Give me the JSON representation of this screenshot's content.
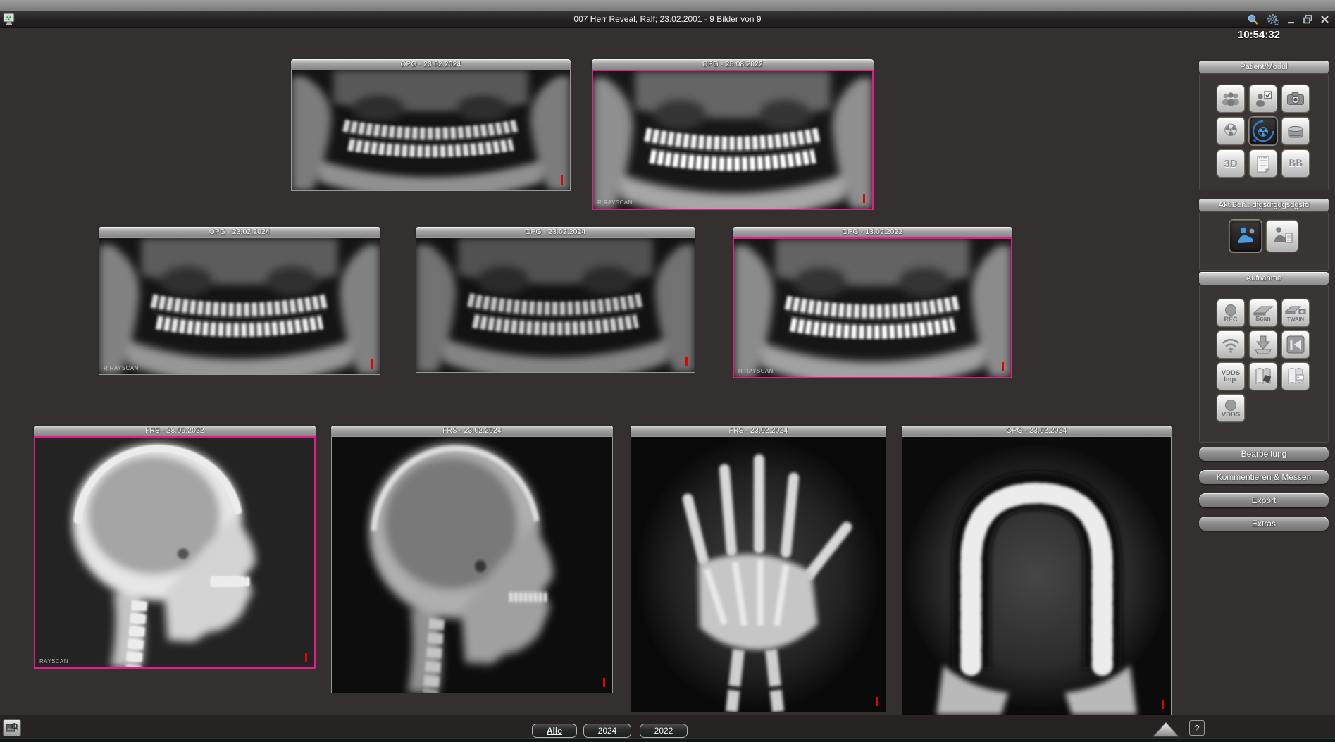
{
  "titlebar": {
    "title": "007 Herr Reveal, Ralf; 23.02.2001 - 9 Bilder von 9"
  },
  "clock": "10:54:32",
  "thumbnails": [
    {
      "label": "OPG - 23.02.2024",
      "selected": false,
      "watermark": ""
    },
    {
      "label": "OPG - 25.08.2022",
      "selected": true,
      "watermark": "R RAYSCAN"
    },
    {
      "label": "OPG - 23.02.2024",
      "selected": false,
      "watermark": "R RAYSCAN"
    },
    {
      "label": "OPG - 23.02.2024",
      "selected": false,
      "watermark": ""
    },
    {
      "label": "OPG - 13.09.2022",
      "selected": true,
      "watermark": "R RAYSCAN"
    },
    {
      "label": "FRS - 28.06.2022",
      "selected": true,
      "watermark": "RAYSCAN"
    },
    {
      "label": "FRS - 23.02.2024",
      "selected": false,
      "watermark": ""
    },
    {
      "label": "FRS - 23.02.2024",
      "selected": false,
      "watermark": ""
    },
    {
      "label": "OPG - 23.02.2024",
      "selected": false,
      "watermark": ""
    }
  ],
  "sidebar": {
    "patient_modul": {
      "title": "Patient/Modul",
      "label_3d": "3D",
      "label_bb": "BB"
    },
    "akt_beh": {
      "title": "Akt.Beh.: dfgsdfgdgsdgsfd"
    },
    "aufnahme": {
      "title": "Aufnahme",
      "rec": "REC",
      "scan": "Scan",
      "twain": "TWAIN",
      "vdds1": "VDDS",
      "vdds2": "Imp.",
      "vdds": "VDDS"
    },
    "buttons": [
      "Bearbeitung",
      "Kommentieren & Messen",
      "Export",
      "Extras"
    ]
  },
  "tabs": [
    {
      "label": "Alle",
      "active": true
    },
    {
      "label": "2024",
      "active": false
    },
    {
      "label": "2022",
      "active": false
    }
  ],
  "help": "?"
}
